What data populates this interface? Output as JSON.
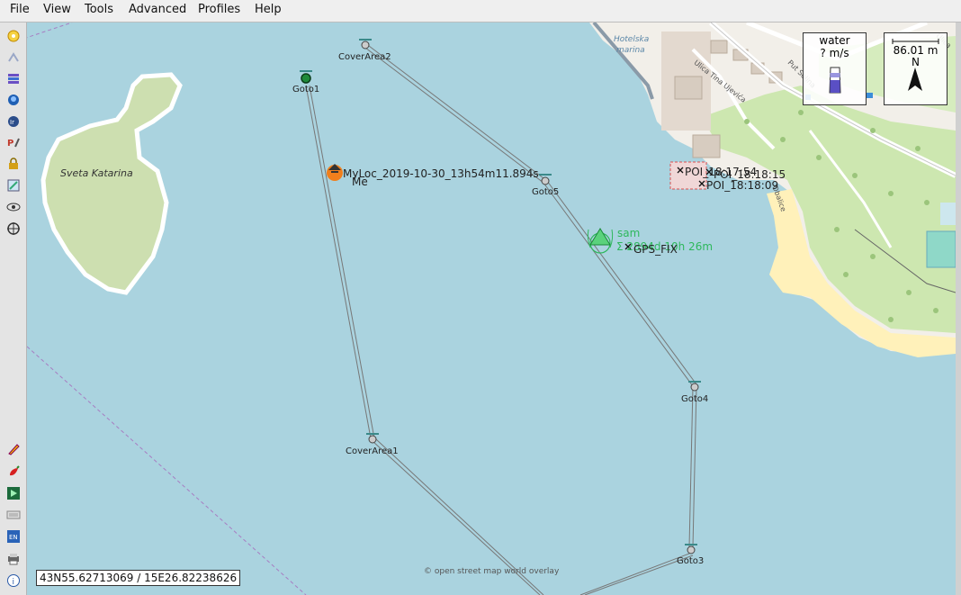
{
  "menu": [
    "File",
    "View",
    "Tools",
    "Advanced",
    "Profiles",
    "Help"
  ],
  "toolbar_icons": [
    "weather-icon",
    "plugin-icon",
    "layers-icon",
    "vehicle-icon",
    "settings-icon",
    "plan-icon",
    "lock-icon",
    "map-edit-icon",
    "eye-icon",
    "target-icon",
    "pencil-icon",
    "pepper-icon",
    "console-icon",
    "keyboard-icon",
    "map-icon",
    "print-icon",
    "info-icon"
  ],
  "map": {
    "island_name": "Sveta Katarina",
    "harbor_name_1": "Hotelska",
    "harbor_name_2": "marina",
    "street_1": "Ulica Tina Ujevića",
    "street_2": "Put Solina",
    "street_3": "Obalice",
    "street_4": "Ulica",
    "waypoints": {
      "goto1": "Goto1",
      "cover2": "CoverArea2",
      "goto5": "Goto5",
      "goto4": "Goto4",
      "cover1": "CoverArea1",
      "goto3": "Goto3"
    },
    "myloc_label": "MyLoc_2019-10-30_13h54m11.894s",
    "me_label": "Me",
    "vehicle_name": "sam",
    "vehicle_status": "Σ 2894d 10h 26m",
    "gps_fix": "GPS_FIX",
    "poi_1": "POI_18:17:54",
    "poi_2": "POI_18:18:15",
    "poi_3": "POI_18:18:09",
    "attribution": "© open street map world overlay"
  },
  "water_panel": {
    "title": "water",
    "value": "? m/s"
  },
  "scale_panel": {
    "distance": "86.01 m",
    "north": "N"
  },
  "coordinates": "43N55.62713069 / 15E26.82238626",
  "colors": {
    "sea": "#aad3df",
    "land": "#f2efe9",
    "park": "#cde7b0",
    "beach": "#fff1ba",
    "vehicle": "#2eb85c"
  }
}
